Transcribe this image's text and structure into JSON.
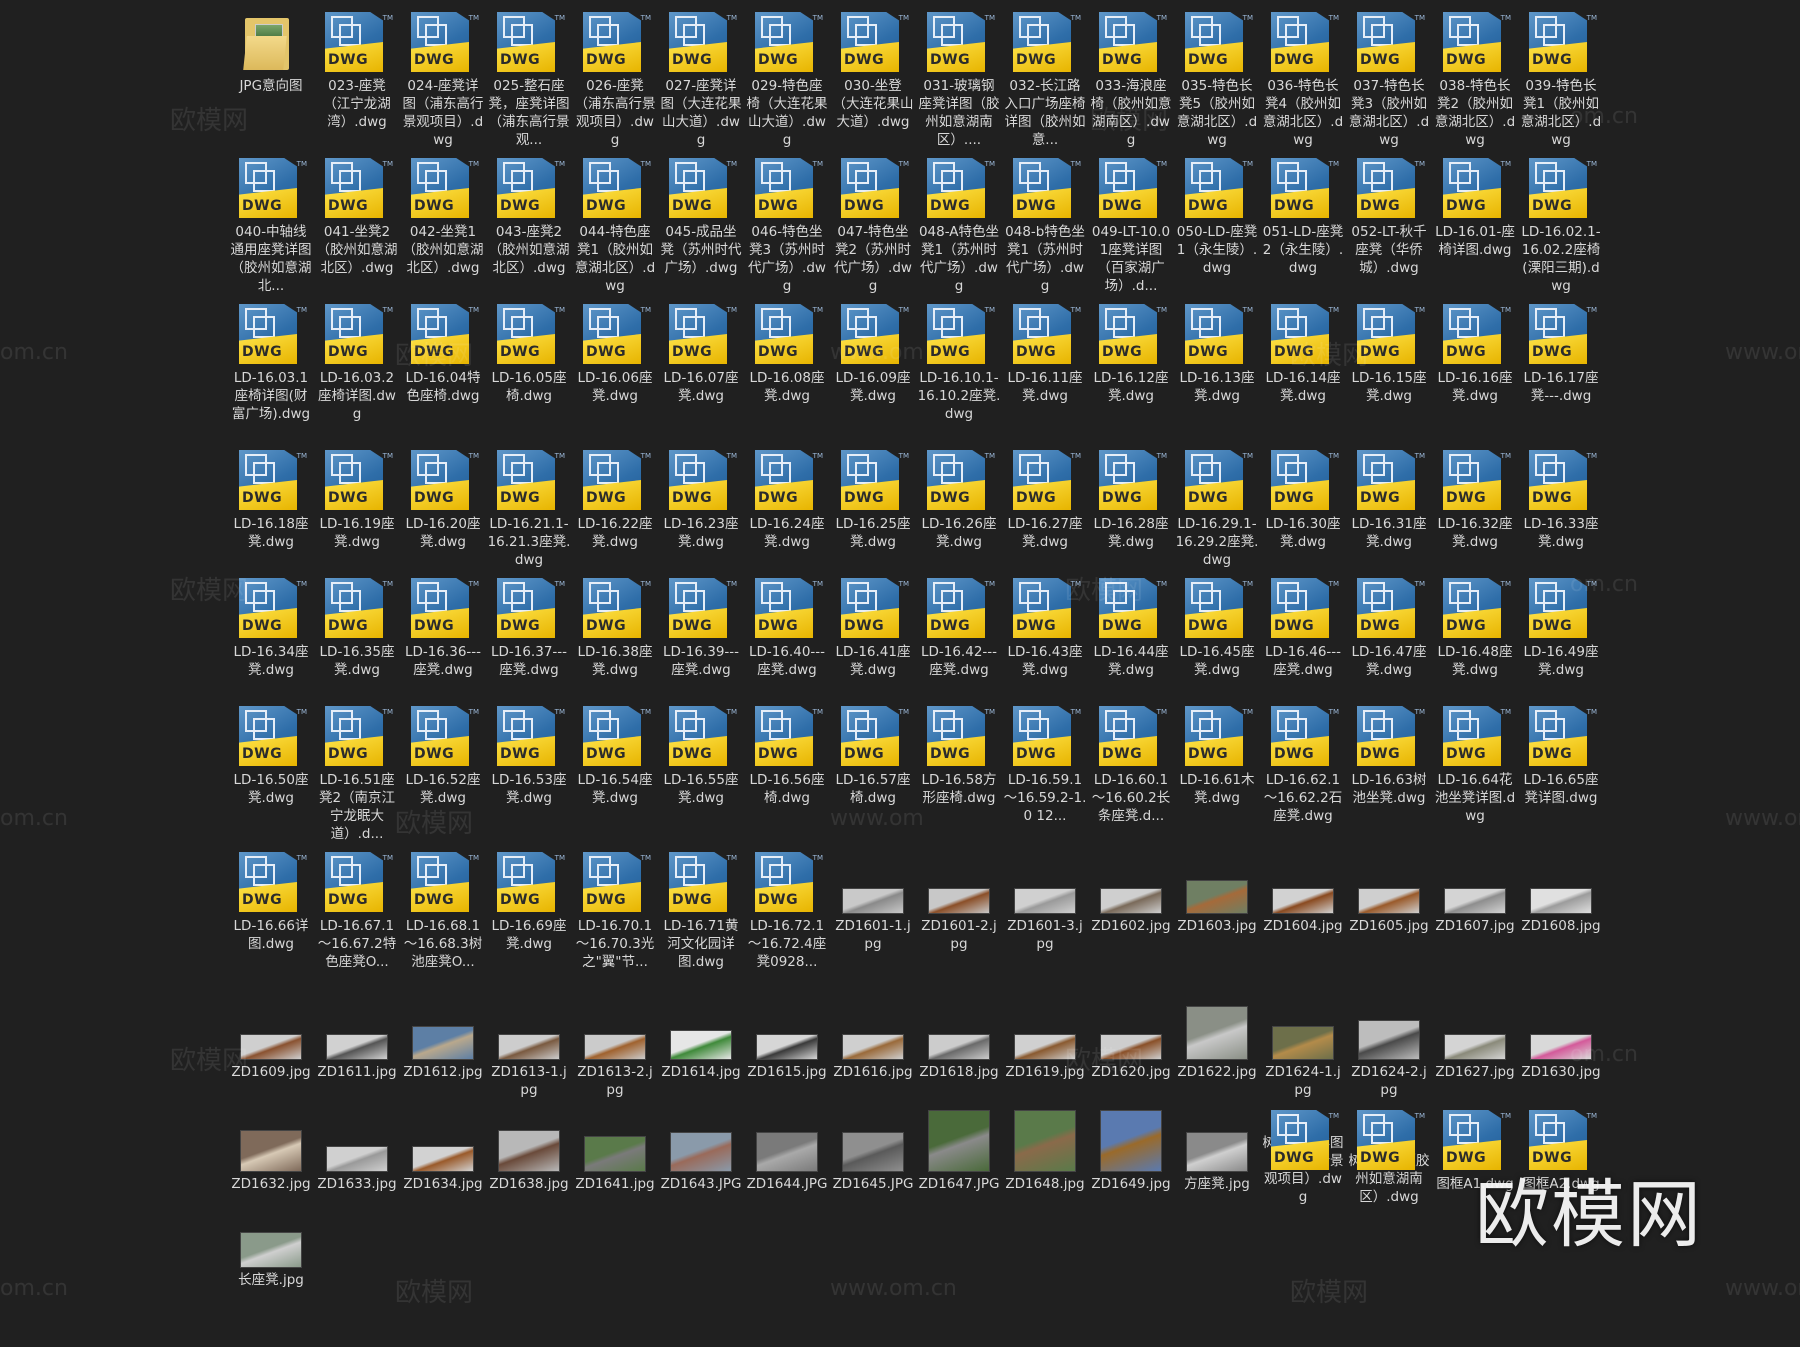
{
  "files": [
    {
      "name": "JPG意向图",
      "type": "folder"
    },
    {
      "name": "023-座凳（江宁龙湖湾）.dwg",
      "type": "dwg"
    },
    {
      "name": "024-座凳详图（浦东高行景观项目）.dwg",
      "type": "dwg"
    },
    {
      "name": "025-整石座凳，座凳详图（浦东高行景观...",
      "type": "dwg"
    },
    {
      "name": "026-座凳（浦东高行景观项目）.dwg",
      "type": "dwg"
    },
    {
      "name": "027-座凳详图（大连花果山大道）.dwg",
      "type": "dwg"
    },
    {
      "name": "029-特色座椅（大连花果山大道）.dwg",
      "type": "dwg"
    },
    {
      "name": "030-坐登（大连花果山大道）.dwg",
      "type": "dwg"
    },
    {
      "name": "031-玻璃钢座凳详图（胶州如意湖南区）....",
      "type": "dwg"
    },
    {
      "name": "032-长江路入口广场座椅详图（胶州如意...",
      "type": "dwg"
    },
    {
      "name": "033-海浪座椅（胶州如意湖南区）.dwg",
      "type": "dwg"
    },
    {
      "name": "035-特色长凳5（胶州如意湖北区）.dwg",
      "type": "dwg"
    },
    {
      "name": "036-特色长凳4（胶州如意湖北区）.dwg",
      "type": "dwg"
    },
    {
      "name": "037-特色长凳3（胶州如意湖北区）.dwg",
      "type": "dwg"
    },
    {
      "name": "038-特色长凳2（胶州如意湖北区）.dwg",
      "type": "dwg"
    },
    {
      "name": "039-特色长凳1（胶州如意湖北区）.dwg",
      "type": "dwg"
    },
    {
      "name": "040-中轴线通用座凳详图（胶州如意湖北...",
      "type": "dwg"
    },
    {
      "name": "041-坐凳2（胶州如意湖北区）.dwg",
      "type": "dwg"
    },
    {
      "name": "042-坐凳1（胶州如意湖北区）.dwg",
      "type": "dwg"
    },
    {
      "name": "043-座凳2（胶州如意湖北区）.dwg",
      "type": "dwg"
    },
    {
      "name": "044-特色座凳1（胶州如意湖北区）.dwg",
      "type": "dwg"
    },
    {
      "name": "045-成品坐凳（苏州时代广场）.dwg",
      "type": "dwg"
    },
    {
      "name": "046-特色坐凳3（苏州时代广场）.dwg",
      "type": "dwg"
    },
    {
      "name": "047-特色坐凳2（苏州时代广场）.dwg",
      "type": "dwg"
    },
    {
      "name": "048-A特色坐凳1（苏州时代广场）.dwg",
      "type": "dwg"
    },
    {
      "name": "048-b特色坐凳1（苏州时代广场）.dwg",
      "type": "dwg"
    },
    {
      "name": "049-LT-10.01座凳详图（百家湖广场）.d...",
      "type": "dwg"
    },
    {
      "name": "050-LD-座凳1（永生陵）.dwg",
      "type": "dwg"
    },
    {
      "name": "051-LD-座凳2（永生陵）.dwg",
      "type": "dwg"
    },
    {
      "name": "052-LT-秋千座凳（华侨城）.dwg",
      "type": "dwg"
    },
    {
      "name": "LD-16.01-座椅详图.dwg",
      "type": "dwg"
    },
    {
      "name": "LD-16.02.1-16.02.2座椅(溧阳三期).dwg",
      "type": "dwg"
    },
    {
      "name": "LD-16.03.1座椅详图(财富广场).dwg",
      "type": "dwg"
    },
    {
      "name": "LD-16.03.2座椅详图.dwg",
      "type": "dwg"
    },
    {
      "name": "LD-16.04特色座椅.dwg",
      "type": "dwg"
    },
    {
      "name": "LD-16.05座椅.dwg",
      "type": "dwg"
    },
    {
      "name": "LD-16.06座凳.dwg",
      "type": "dwg"
    },
    {
      "name": "LD-16.07座凳.dwg",
      "type": "dwg"
    },
    {
      "name": "LD-16.08座凳.dwg",
      "type": "dwg"
    },
    {
      "name": "LD-16.09座凳.dwg",
      "type": "dwg"
    },
    {
      "name": "LD-16.10.1-16.10.2座凳.dwg",
      "type": "dwg"
    },
    {
      "name": "LD-16.11座凳.dwg",
      "type": "dwg"
    },
    {
      "name": "LD-16.12座凳.dwg",
      "type": "dwg"
    },
    {
      "name": "LD-16.13座凳.dwg",
      "type": "dwg"
    },
    {
      "name": "LD-16.14座凳.dwg",
      "type": "dwg"
    },
    {
      "name": "LD-16.15座凳.dwg",
      "type": "dwg"
    },
    {
      "name": "LD-16.16座凳.dwg",
      "type": "dwg"
    },
    {
      "name": "LD-16.17座凳---.dwg",
      "type": "dwg"
    },
    {
      "name": "LD-16.18座凳.dwg",
      "type": "dwg"
    },
    {
      "name": "LD-16.19座凳.dwg",
      "type": "dwg"
    },
    {
      "name": "LD-16.20座凳.dwg",
      "type": "dwg"
    },
    {
      "name": "LD-16.21.1-16.21.3座凳.dwg",
      "type": "dwg"
    },
    {
      "name": "LD-16.22座凳.dwg",
      "type": "dwg"
    },
    {
      "name": "LD-16.23座凳.dwg",
      "type": "dwg"
    },
    {
      "name": "LD-16.24座凳.dwg",
      "type": "dwg"
    },
    {
      "name": "LD-16.25座凳.dwg",
      "type": "dwg"
    },
    {
      "name": "LD-16.26座凳.dwg",
      "type": "dwg"
    },
    {
      "name": "LD-16.27座凳.dwg",
      "type": "dwg"
    },
    {
      "name": "LD-16.28座凳.dwg",
      "type": "dwg"
    },
    {
      "name": "LD-16.29.1-16.29.2座凳.dwg",
      "type": "dwg"
    },
    {
      "name": "LD-16.30座凳.dwg",
      "type": "dwg"
    },
    {
      "name": "LD-16.31座凳.dwg",
      "type": "dwg"
    },
    {
      "name": "LD-16.32座凳.dwg",
      "type": "dwg"
    },
    {
      "name": "LD-16.33座凳.dwg",
      "type": "dwg"
    },
    {
      "name": "LD-16.34座凳.dwg",
      "type": "dwg"
    },
    {
      "name": "LD-16.35座凳.dwg",
      "type": "dwg"
    },
    {
      "name": "LD-16.36---座凳.dwg",
      "type": "dwg"
    },
    {
      "name": "LD-16.37---座凳.dwg",
      "type": "dwg"
    },
    {
      "name": "LD-16.38座凳.dwg",
      "type": "dwg"
    },
    {
      "name": "LD-16.39---座凳.dwg",
      "type": "dwg"
    },
    {
      "name": "LD-16.40---座凳.dwg",
      "type": "dwg"
    },
    {
      "name": "LD-16.41座凳.dwg",
      "type": "dwg"
    },
    {
      "name": "LD-16.42---座凳.dwg",
      "type": "dwg"
    },
    {
      "name": "LD-16.43座凳.dwg",
      "type": "dwg"
    },
    {
      "name": "LD-16.44座凳.dwg",
      "type": "dwg"
    },
    {
      "name": "LD-16.45座凳.dwg",
      "type": "dwg"
    },
    {
      "name": "LD-16.46---座凳.dwg",
      "type": "dwg"
    },
    {
      "name": "LD-16.47座凳.dwg",
      "type": "dwg"
    },
    {
      "name": "LD-16.48座凳.dwg",
      "type": "dwg"
    },
    {
      "name": "LD-16.49座凳.dwg",
      "type": "dwg"
    },
    {
      "name": "LD-16.50座凳.dwg",
      "type": "dwg"
    },
    {
      "name": "LD-16.51座凳2（南京江宁龙眠大道）.d...",
      "type": "dwg"
    },
    {
      "name": "LD-16.52座凳.dwg",
      "type": "dwg"
    },
    {
      "name": "LD-16.53座凳.dwg",
      "type": "dwg"
    },
    {
      "name": "LD-16.54座凳.dwg",
      "type": "dwg"
    },
    {
      "name": "LD-16.55座凳.dwg",
      "type": "dwg"
    },
    {
      "name": "LD-16.56座椅.dwg",
      "type": "dwg"
    },
    {
      "name": "LD-16.57座椅.dwg",
      "type": "dwg"
    },
    {
      "name": "LD-16.58方形座椅.dwg",
      "type": "dwg"
    },
    {
      "name": "LD-16.59.1～16.59.2-1.0 12...",
      "type": "dwg"
    },
    {
      "name": "LD-16.60.1～16.60.2长条座凳.d...",
      "type": "dwg"
    },
    {
      "name": "LD-16.61木凳.dwg",
      "type": "dwg"
    },
    {
      "name": "LD-16.62.1～16.62.2石座凳.dwg",
      "type": "dwg"
    },
    {
      "name": "LD-16.63树池坐凳.dwg",
      "type": "dwg"
    },
    {
      "name": "LD-16.64花池坐凳详图.dwg",
      "type": "dwg"
    },
    {
      "name": "LD-16.65座凳详图.dwg",
      "type": "dwg"
    },
    {
      "name": "LD-16.66详图.dwg",
      "type": "dwg"
    },
    {
      "name": "LD-16.67.1～16.67.2特色座凳O...",
      "type": "dwg"
    },
    {
      "name": "LD-16.68.1～16.68.3树池座凳O...",
      "type": "dwg"
    },
    {
      "name": "LD-16.69座凳.dwg",
      "type": "dwg"
    },
    {
      "name": "LD-16.70.1～16.70.3光之\"翼\"节...",
      "type": "dwg"
    },
    {
      "name": "LD-16.71黄河文化园详图.dwg",
      "type": "dwg"
    },
    {
      "name": "LD-16.72.1～16.72.4座凳0928...",
      "type": "dwg"
    },
    {
      "name": "ZD1601-1.jpg",
      "type": "jpg",
      "c1": "#c9c9c9",
      "c2": "#8a8a8a",
      "h": 26
    },
    {
      "name": "ZD1601-2.jpg",
      "type": "jpg",
      "c1": "#c8c8c8",
      "c2": "#8b4f28",
      "h": 26
    },
    {
      "name": "ZD1601-3.jpg",
      "type": "jpg",
      "c1": "#d0d0d0",
      "c2": "#9a9a9a",
      "h": 26
    },
    {
      "name": "ZD1602.jpg",
      "type": "jpg",
      "c1": "#cfcfcf",
      "c2": "#7a6a5a",
      "h": 26
    },
    {
      "name": "ZD1603.jpg",
      "type": "jpg",
      "c1": "#6f7f63",
      "c2": "#a56a3a",
      "h": 34
    },
    {
      "name": "ZD1604.jpg",
      "type": "jpg",
      "c1": "#d2d2d2",
      "c2": "#8a4a20",
      "h": 26
    },
    {
      "name": "ZD1605.jpg",
      "type": "jpg",
      "c1": "#cfcfcf",
      "c2": "#9a5a2a",
      "h": 26
    },
    {
      "name": "ZD1607.jpg",
      "type": "jpg",
      "c1": "#d4d4d4",
      "c2": "#8e8e8e",
      "h": 26
    },
    {
      "name": "ZD1608.jpg",
      "type": "jpg",
      "c1": "#e0e0e0",
      "c2": "#9c9c9c",
      "h": 26
    },
    {
      "name": "ZD1609.jpg",
      "type": "jpg",
      "c1": "#cfcfcf",
      "c2": "#8a5230",
      "h": 26
    },
    {
      "name": "ZD1611.jpg",
      "type": "jpg",
      "c1": "#d1d1d1",
      "c2": "#555555",
      "h": 26
    },
    {
      "name": "ZD1612.jpg",
      "type": "jpg",
      "c1": "#5d7fa5",
      "c2": "#b9a88c",
      "h": 34
    },
    {
      "name": "ZD1613-1.jpg",
      "type": "jpg",
      "c1": "#cdcdcd",
      "c2": "#7a5a40",
      "h": 26
    },
    {
      "name": "ZD1613-2.jpg",
      "type": "jpg",
      "c1": "#cbcbcb",
      "c2": "#a0622e",
      "h": 26
    },
    {
      "name": "ZD1614.jpg",
      "type": "jpg",
      "c1": "#e6e6e6",
      "c2": "#3f8a3a",
      "h": 30
    },
    {
      "name": "ZD1615.jpg",
      "type": "jpg",
      "c1": "#d6d6d6",
      "c2": "#3a3a3a",
      "h": 26
    },
    {
      "name": "ZD1616.jpg",
      "type": "jpg",
      "c1": "#cfcfcf",
      "c2": "#9a6a3a",
      "h": 26
    },
    {
      "name": "ZD1618.jpg",
      "type": "jpg",
      "c1": "#cccccc",
      "c2": "#6a6a6a",
      "h": 26
    },
    {
      "name": "ZD1619.jpg",
      "type": "jpg",
      "c1": "#d0d0d0",
      "c2": "#8a5a30",
      "h": 26
    },
    {
      "name": "ZD1620.jpg",
      "type": "jpg",
      "c1": "#cecece",
      "c2": "#8a5028",
      "h": 26
    },
    {
      "name": "ZD1622.jpg",
      "type": "jpg",
      "c1": "#8a8f86",
      "c2": "#c8c8c8",
      "h": 54
    },
    {
      "name": "ZD1624-1.jpg",
      "type": "jpg",
      "c1": "#6d6f4a",
      "c2": "#b38b4a",
      "h": 34
    },
    {
      "name": "ZD1624-2.jpg",
      "type": "jpg",
      "c1": "#bdbdbd",
      "c2": "#4a4a4a",
      "h": 40
    },
    {
      "name": "ZD1627.jpg",
      "type": "jpg",
      "c1": "#d4d4d4",
      "c2": "#8a8a7a",
      "h": 26
    },
    {
      "name": "ZD1630.jpg",
      "type": "jpg",
      "c1": "#d9d9d9",
      "c2": "#d45a9a",
      "h": 26
    },
    {
      "name": "ZD1632.jpg",
      "type": "jpg",
      "c1": "#7f6a5a",
      "c2": "#d7c9b5",
      "h": 42
    },
    {
      "name": "ZD1633.jpg",
      "type": "jpg",
      "c1": "#d0d0d0",
      "c2": "#9a9a9a",
      "h": 26
    },
    {
      "name": "ZD1634.jpg",
      "type": "jpg",
      "c1": "#d2d2d2",
      "c2": "#9a5a2a",
      "h": 26
    },
    {
      "name": "ZD1638.jpg",
      "type": "jpg",
      "c1": "#b8b8b8",
      "c2": "#6a4a3a",
      "h": 42
    },
    {
      "name": "ZD1641.jpg",
      "type": "jpg",
      "c1": "#5a7a4a",
      "c2": "#7a7a7a",
      "h": 36
    },
    {
      "name": "ZD1643.JPG",
      "type": "jpg",
      "c1": "#8a9aaa",
      "c2": "#9a6a5a",
      "h": 40
    },
    {
      "name": "ZD1644.JPG",
      "type": "jpg",
      "c1": "#7a7a7a",
      "c2": "#a9a9a9",
      "h": 40
    },
    {
      "name": "ZD1645.JPG",
      "type": "jpg",
      "c1": "#8f8f8f",
      "c2": "#5a5a5a",
      "h": 40
    },
    {
      "name": "ZD1647.JPG",
      "type": "jpg",
      "c1": "#4a6a3a",
      "c2": "#8a8a8a",
      "h": 62
    },
    {
      "name": "ZD1648.jpg",
      "type": "jpg",
      "c1": "#5a7a4a",
      "c2": "#8a6a4a",
      "h": 62
    },
    {
      "name": "ZD1649.jpg",
      "type": "jpg",
      "c1": "#5a7ab0",
      "c2": "#9a6a2a",
      "h": 62
    },
    {
      "name": "方座凳.jpg",
      "type": "jpg",
      "c1": "#8a8a8a",
      "c2": "#cfcfcf",
      "h": 40
    },
    {
      "name": "树池座凳详图（浦东高行景观项目）.dwg",
      "type": "dwg"
    },
    {
      "name": "树池座椅（胶州如意湖南区）.dwg",
      "type": "dwg"
    },
    {
      "name": "图框A1.dwg",
      "type": "dwg"
    },
    {
      "name": "图框A2.dwg",
      "type": "dwg"
    },
    {
      "name": "长座凳.jpg",
      "type": "jpg",
      "c1": "#8a9a8a",
      "c2": "#cfcfcf",
      "h": 36
    }
  ],
  "dwg_badge": "DWG",
  "tm_mark": "TM",
  "watermark_big": "欧模网",
  "watermarks": [
    "欧模网",
    "www.om.cn",
    "om.cn",
    "www.om"
  ]
}
